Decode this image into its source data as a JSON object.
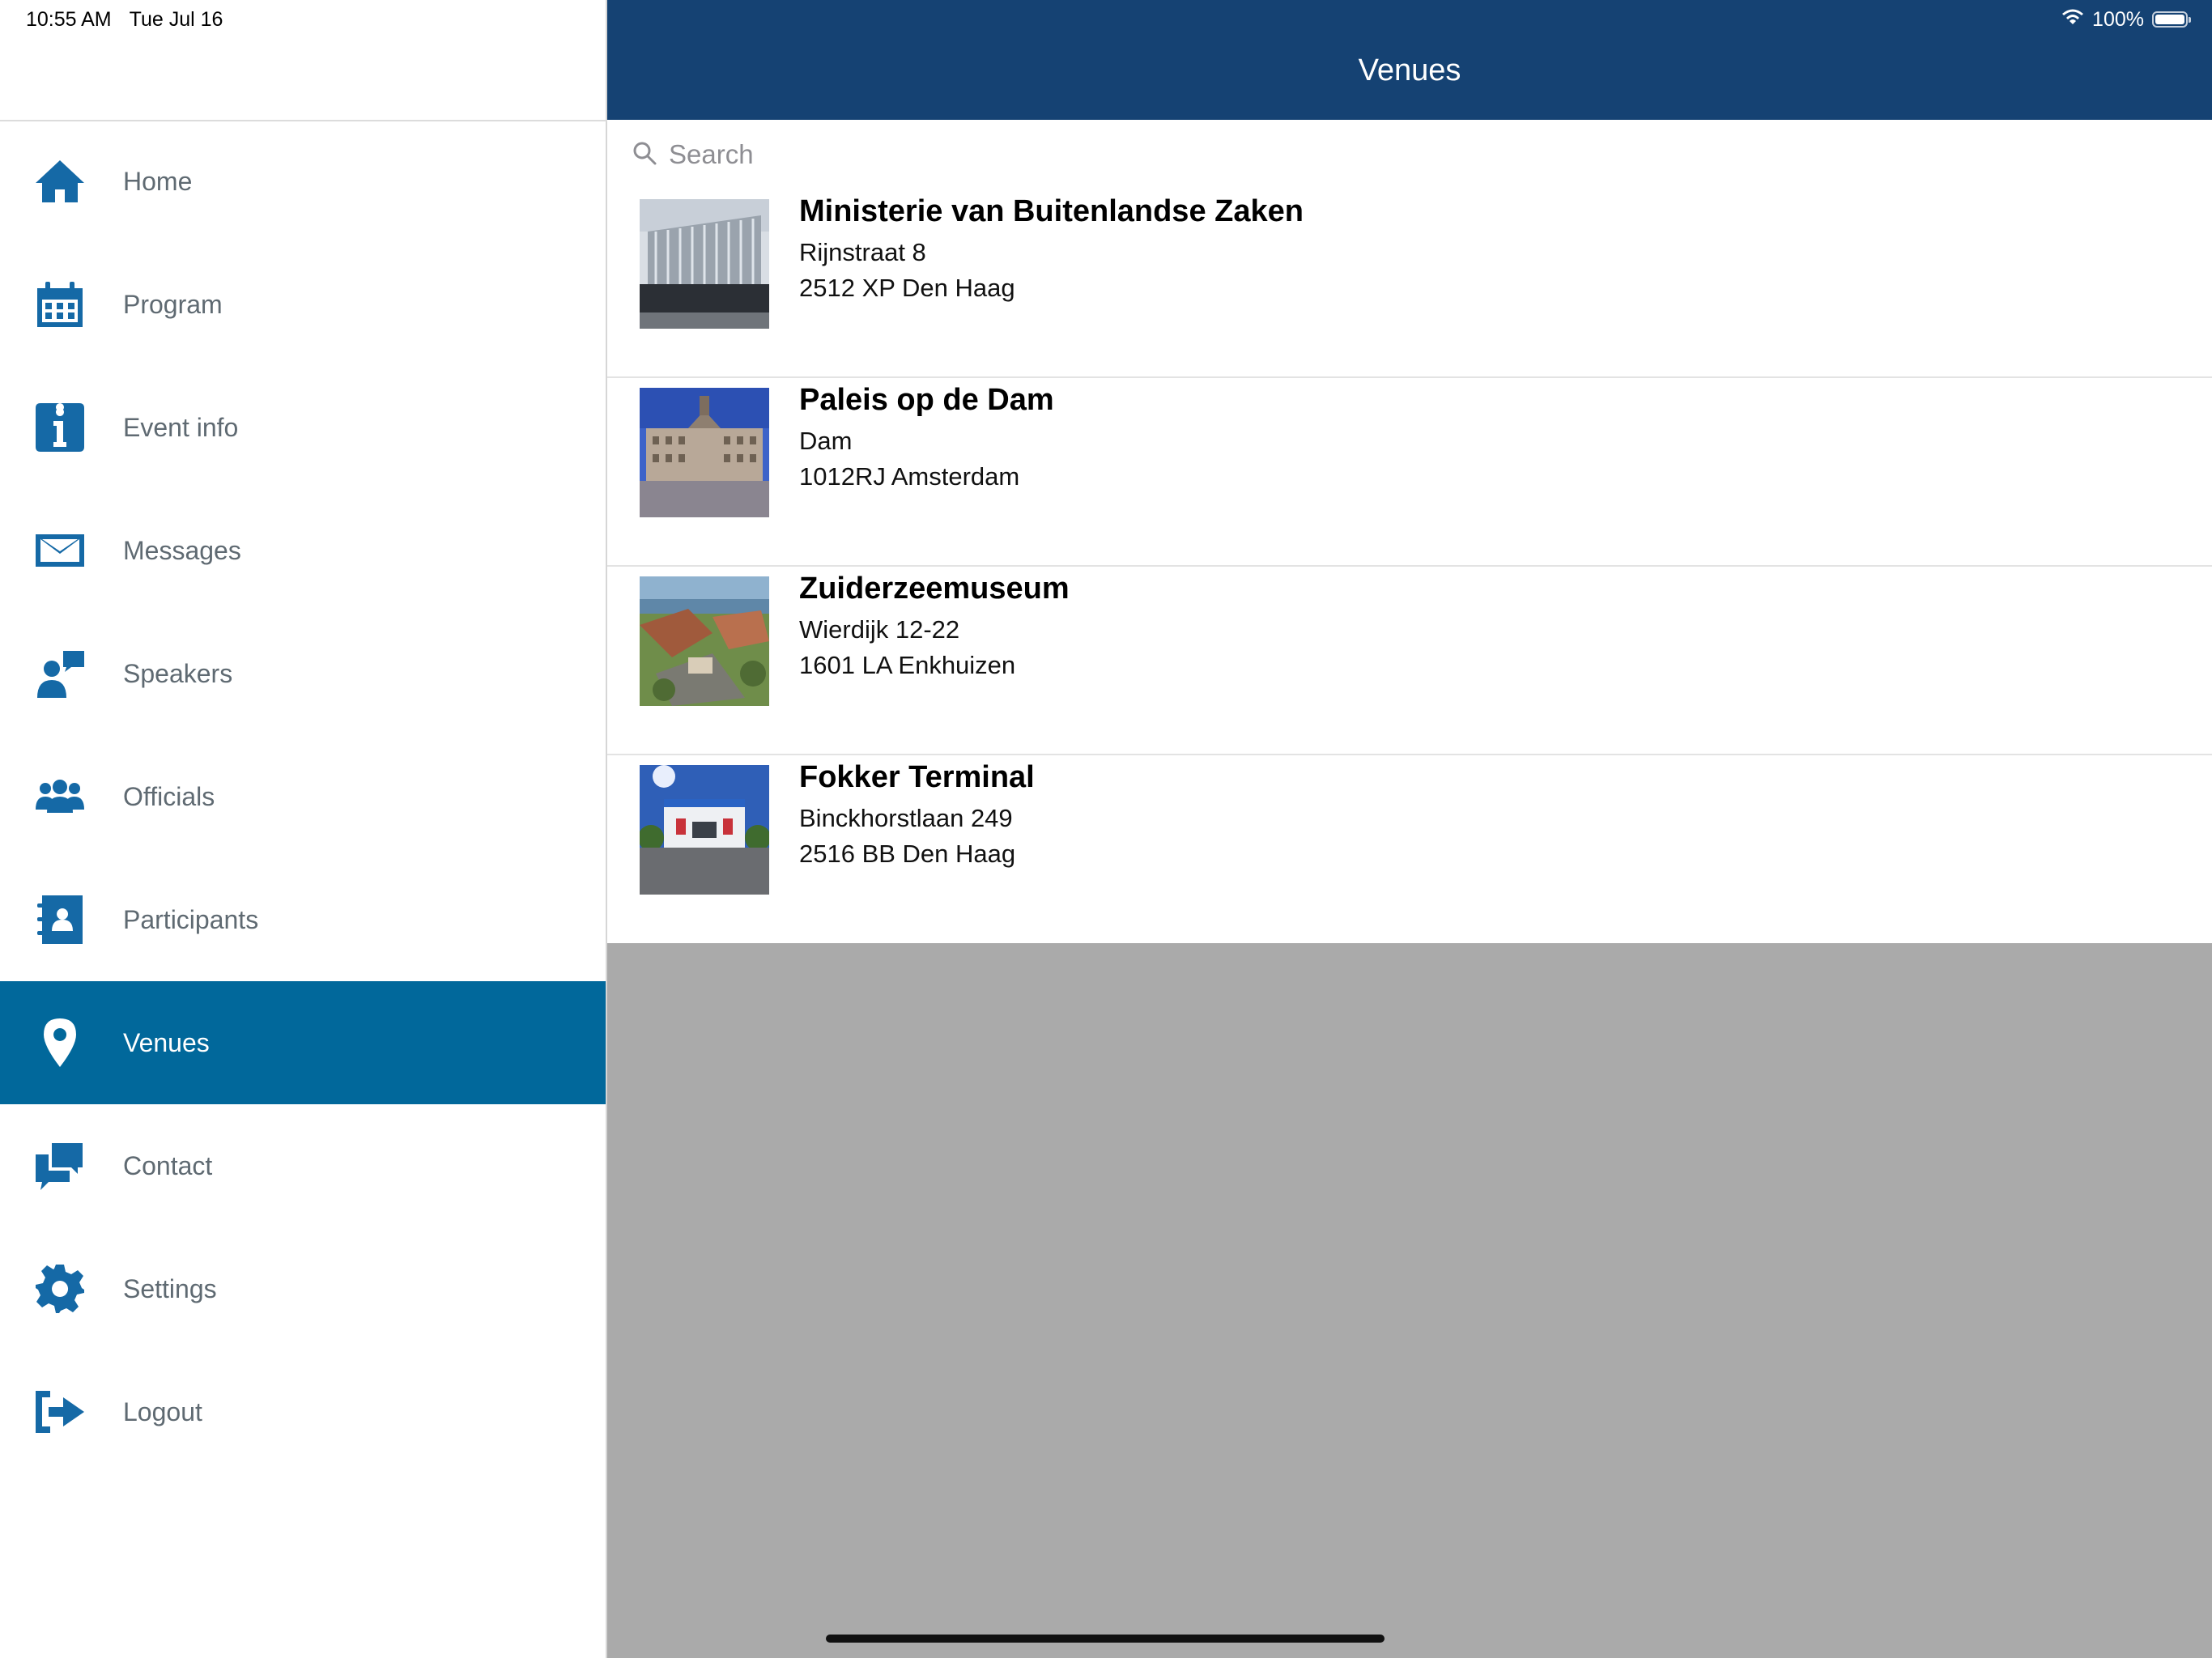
{
  "status_bar": {
    "time": "10:55 AM",
    "date": "Tue Jul 16",
    "battery": "100%"
  },
  "sidebar": {
    "items": [
      {
        "label": "Home",
        "icon": "home-icon",
        "active": false
      },
      {
        "label": "Program",
        "icon": "calendar-icon",
        "active": false
      },
      {
        "label": "Event info",
        "icon": "info-icon",
        "active": false
      },
      {
        "label": "Messages",
        "icon": "envelope-icon",
        "active": false
      },
      {
        "label": "Speakers",
        "icon": "speaker-icon",
        "active": false
      },
      {
        "label": "Officials",
        "icon": "group-icon",
        "active": false
      },
      {
        "label": "Participants",
        "icon": "contact-book-icon",
        "active": false
      },
      {
        "label": "Venues",
        "icon": "map-pin-icon",
        "active": true
      },
      {
        "label": "Contact",
        "icon": "chat-bubbles-icon",
        "active": false
      },
      {
        "label": "Settings",
        "icon": "gear-icon",
        "active": false
      },
      {
        "label": "Logout",
        "icon": "logout-icon",
        "active": false
      }
    ]
  },
  "header": {
    "title": "Venues"
  },
  "search": {
    "placeholder": "Search",
    "value": ""
  },
  "venues": [
    {
      "name": "Ministerie van Buitenlandse Zaken",
      "street": "Rijnstraat 8",
      "city": "2512 XP Den Haag"
    },
    {
      "name": "Paleis op de Dam",
      "street": "Dam",
      "city": "1012RJ Amsterdam"
    },
    {
      "name": "Zuiderzeemuseum",
      "street": "Wierdijk 12-22",
      "city": "1601 LA Enkhuizen"
    },
    {
      "name": "Fokker Terminal",
      "street": "Binckhorstlaan 249",
      "city": "2516 BB Den Haag"
    }
  ],
  "colors": {
    "navbar": "#154273",
    "active_menu": "#01689b",
    "icon": "#1569a6",
    "empty_area": "#aaaaaa"
  }
}
